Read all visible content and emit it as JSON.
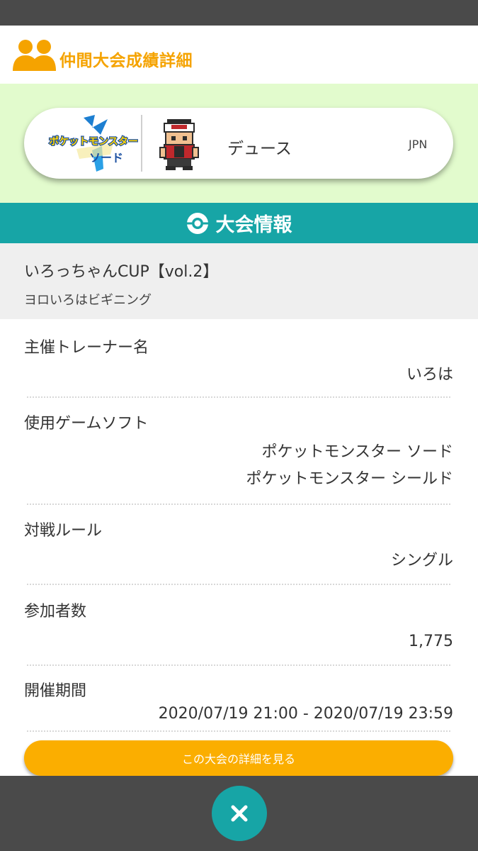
{
  "header": {
    "title": "仲間大会成績詳細",
    "icon": "people-icon"
  },
  "profile": {
    "game_logo_text_top": "ポケットモンスター",
    "game_logo_text_bottom": "ソード",
    "player_name": "デュース",
    "region": "JPN"
  },
  "section": {
    "title": "大会情報",
    "icon": "monster-ball-icon"
  },
  "tournament": {
    "name": "いろっちゃんCUP【vol.2】",
    "subtitle": "ヨロいろはビギニング"
  },
  "details": {
    "organizer_label": "主催トレーナー名",
    "organizer_value": "いろは",
    "games_label": "使用ゲームソフト",
    "games": [
      "ポケットモンスター ソード",
      "ポケットモンスター シールド"
    ],
    "rule_label": "対戦ルール",
    "rule_value": "シングル",
    "participants_label": "参加者数",
    "participants_value": "1,775",
    "period_label": "開催期間",
    "period_value": "2020/07/19 21:00 - 2020/07/19 23:59"
  },
  "actions": {
    "detail_button": "この大会の詳細を見る",
    "close_icon": "close-icon"
  },
  "colors": {
    "accent": "#f5a300",
    "teal": "#17a5a6",
    "green_bg": "#e2fbcd",
    "button": "#fbae00"
  }
}
